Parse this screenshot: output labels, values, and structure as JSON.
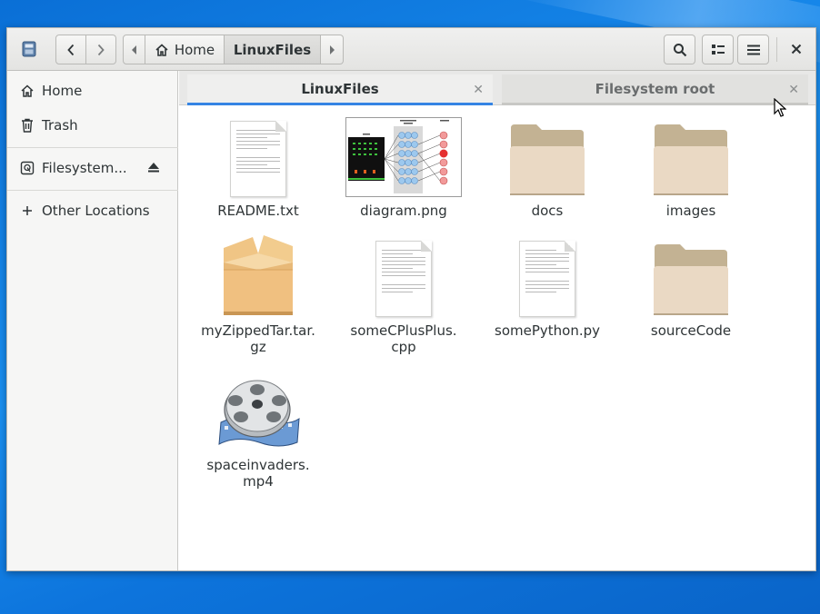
{
  "window": {
    "pathbar": {
      "home_label": "Home",
      "current_label": "LinuxFiles"
    }
  },
  "sidebar": {
    "items": [
      {
        "label": "Home",
        "icon": "home-icon"
      },
      {
        "label": "Trash",
        "icon": "trash-icon"
      },
      {
        "label": "Filesystem...",
        "icon": "drive-icon"
      },
      {
        "label": "Other Locations",
        "icon": "plus-icon"
      }
    ]
  },
  "tabs": [
    {
      "label": "LinuxFiles",
      "active": true
    },
    {
      "label": "Filesystem root",
      "active": false
    }
  ],
  "files": [
    {
      "name": "README.txt",
      "type": "text"
    },
    {
      "name": "diagram.png",
      "type": "image"
    },
    {
      "name": "docs",
      "type": "folder"
    },
    {
      "name": "images",
      "type": "folder"
    },
    {
      "name": "myZippedTar.tar.\ngz",
      "type": "archive"
    },
    {
      "name": "someCPlusPlus.\ncpp",
      "type": "text"
    },
    {
      "name": "somePython.py",
      "type": "text"
    },
    {
      "name": "sourceCode",
      "type": "folder"
    },
    {
      "name": "spaceinvaders.\nmp4",
      "type": "video"
    }
  ],
  "colors": {
    "accent": "#3584e4",
    "folder_back": "#c3b293",
    "folder_front": "#ead9c4",
    "desktop": "#1a8ff0"
  }
}
